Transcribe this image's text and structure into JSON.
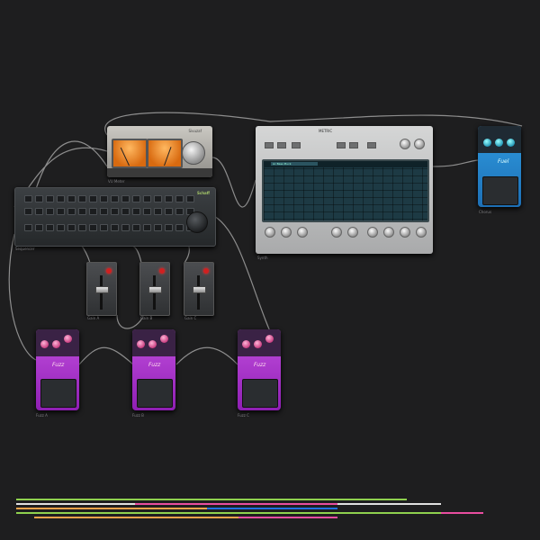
{
  "devices": {
    "vu_meter": {
      "brand": "Sivuzaf",
      "label": "VU Meter"
    },
    "sequencer": {
      "brand": "Schaff",
      "label": "Sequencer"
    },
    "synth": {
      "title": "METRIC",
      "preset": "Ac Bass Pluck",
      "label": "Synth"
    },
    "blue_pedal": {
      "logo": "Fuel",
      "label": "Chorus"
    },
    "faders": [
      {
        "label": "Gain A"
      },
      {
        "label": "Gain B"
      },
      {
        "label": "Gain C"
      }
    ],
    "purple_pedals": [
      {
        "logo": "Fuzz",
        "label": "Fuzz A"
      },
      {
        "logo": "Fuzz",
        "label": "Fuzz B"
      },
      {
        "logo": "Fuzz",
        "label": "Fuzz C"
      }
    ]
  },
  "timeline": {
    "colors": {
      "green": "#8fd14f",
      "orange": "#f0a24a",
      "purple": "#8a2be2",
      "pink": "#e94da0",
      "blue": "#1e6fe0",
      "white": "#e0e0e0"
    },
    "tracks": [
      {
        "segments": [
          {
            "start": 18,
            "end": 452,
            "color": "#8fd14f"
          }
        ]
      },
      {
        "segments": [
          {
            "start": 18,
            "end": 490,
            "color": "#e0e0e0"
          },
          {
            "start": 150,
            "end": 375,
            "color": "#e94da0"
          }
        ]
      },
      {
        "segments": [
          {
            "start": 18,
            "end": 375,
            "color": "#f0a24a"
          },
          {
            "start": 230,
            "end": 375,
            "color": "#1e6fe0"
          }
        ]
      },
      {
        "segments": [
          {
            "start": 18,
            "end": 537,
            "color": "#8fd14f"
          },
          {
            "start": 490,
            "end": 537,
            "color": "#e94da0"
          }
        ]
      },
      {
        "segments": [
          {
            "start": 38,
            "end": 375,
            "color": "#f0a24a"
          },
          {
            "start": 265,
            "end": 375,
            "color": "#e94da0"
          }
        ]
      }
    ]
  }
}
